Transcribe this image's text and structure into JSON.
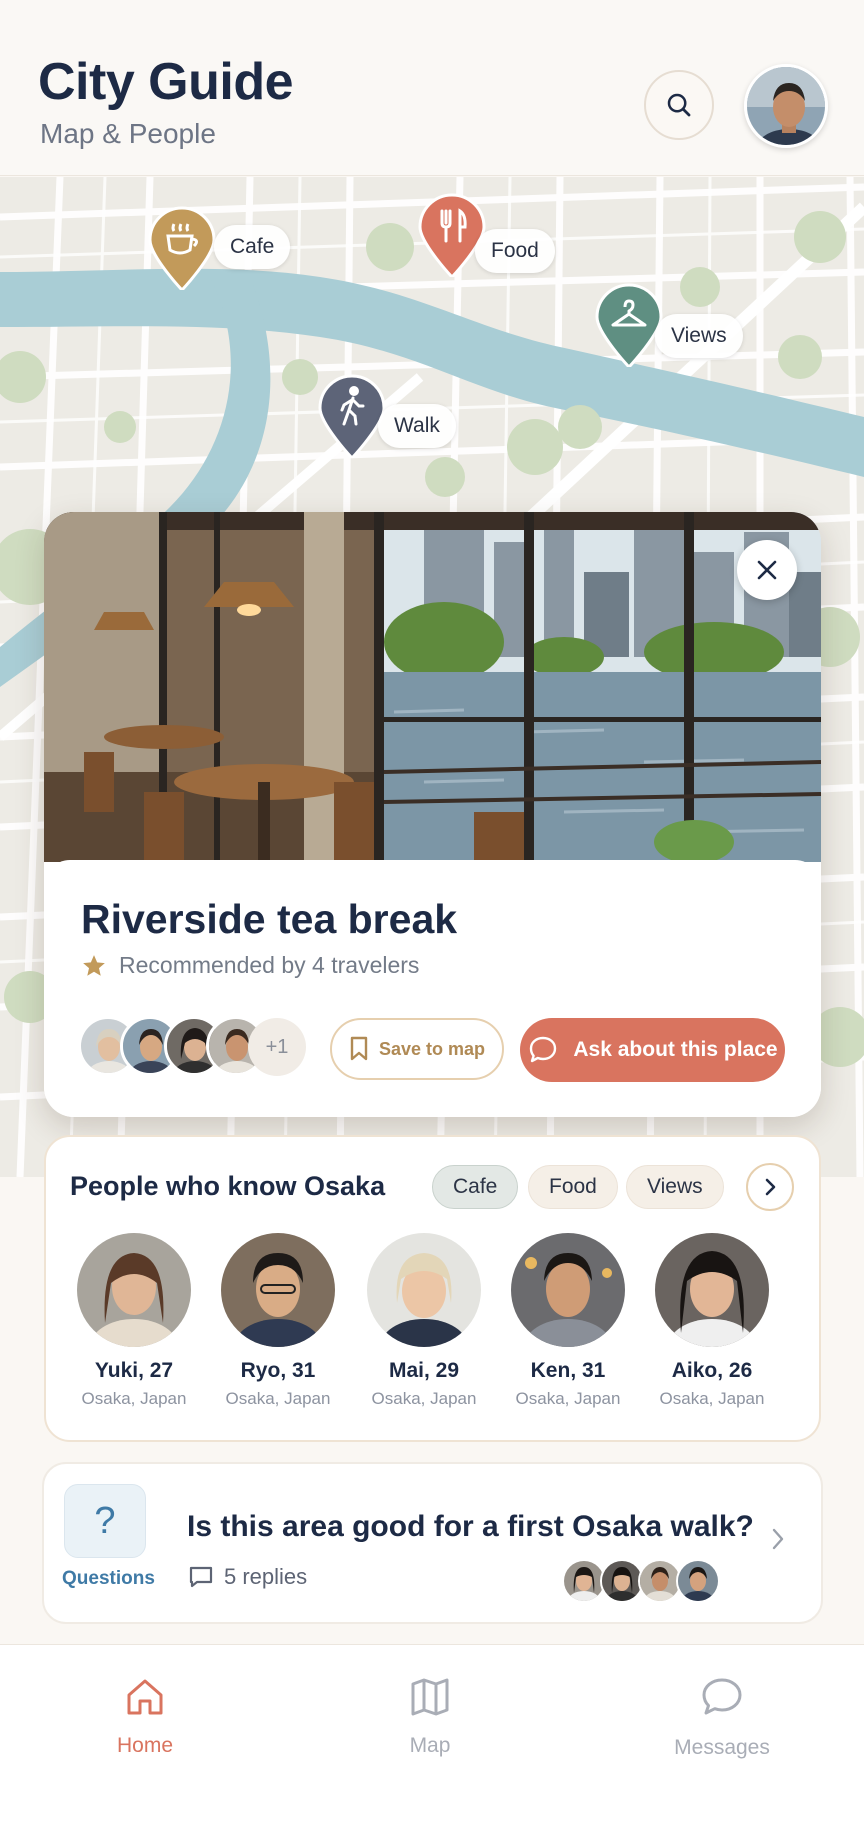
{
  "header": {
    "title": "City Guide",
    "subtitle": "Map & People"
  },
  "map": {
    "pins": [
      {
        "label": "Cafe",
        "icon": "coffee-cup-icon",
        "color": "#c29a5a"
      },
      {
        "label": "Food",
        "icon": "fork-knife-icon",
        "color": "#d9745f"
      },
      {
        "label": "Views",
        "icon": "hanger-icon",
        "color": "#5f8f82"
      },
      {
        "label": "Walk",
        "icon": "walking-person-icon",
        "color": "#5d6478"
      }
    ]
  },
  "place": {
    "title": "Riverside tea break",
    "recommendation": "Recommended by 4 travelers",
    "extra_count": "+1",
    "save_label": "Save to map",
    "ask_label": "Ask about this place"
  },
  "people": {
    "title": "People who know Osaka",
    "filters": [
      "Cafe",
      "Food",
      "Views"
    ],
    "active_filter": "Cafe",
    "list": [
      {
        "name": "Yuki, 27",
        "location": "Osaka, Japan"
      },
      {
        "name": "Ryo, 31",
        "location": "Osaka, Japan"
      },
      {
        "name": "Mai, 29",
        "location": "Osaka, Japan"
      },
      {
        "name": "Ken, 31",
        "location": "Osaka, Japan"
      },
      {
        "name": "Aiko, 26",
        "location": "Osaka, Japan"
      }
    ]
  },
  "question": {
    "section_label": "Questions",
    "icon_glyph": "?",
    "title": "Is this area good for a first Osaka walk?",
    "replies": "5 replies"
  },
  "tabs": [
    {
      "label": "Home",
      "icon": "home-icon"
    },
    {
      "label": "Map",
      "icon": "map-icon"
    },
    {
      "label": "Messages",
      "icon": "chat-bubble-icon"
    }
  ],
  "colors": {
    "accent": "#d9745f",
    "gold": "#c29a5a",
    "teal": "#5f8f82",
    "navy": "#1d2a45",
    "question_blue": "#3f7aa6"
  }
}
